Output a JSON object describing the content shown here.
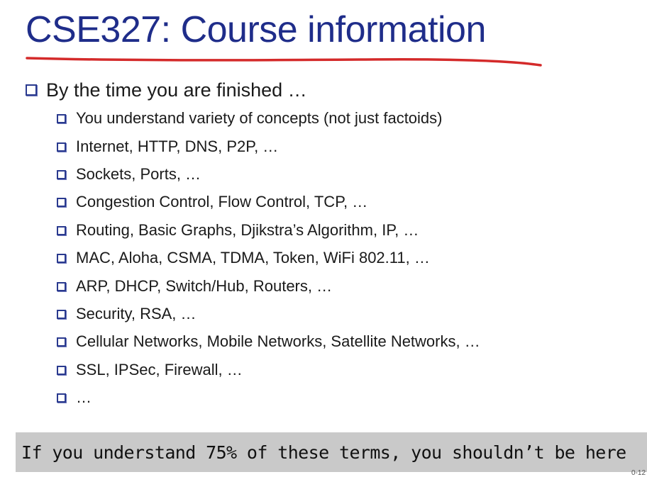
{
  "slide": {
    "title": "CSE327: Course information",
    "main_bullet": "By the time you are finished …",
    "sub_bullets": [
      "You understand variety of concepts (not just factoids)",
      "Internet, HTTP, DNS, P2P, …",
      "Sockets, Ports, …",
      "Congestion Control, Flow Control, TCP, …",
      "Routing, Basic Graphs, Djikstra’s Algorithm, IP, …",
      "MAC, Aloha, CSMA, TDMA, Token, WiFi 802.11, …",
      "ARP, DHCP, Switch/Hub, Routers, …",
      "Security, RSA, …",
      "Cellular Networks, Mobile Networks, Satellite Networks, …",
      "SSL, IPSec, Firewall, …",
      "…"
    ],
    "callout": "If you understand 75% of these terms, you shouldn’t be here",
    "page_number": "0-12"
  },
  "colors": {
    "title": "#1f2d8a",
    "underline": "#d42a2a",
    "bullet_box": "#2a3a8f",
    "callout_bg": "#c9c9c9"
  }
}
